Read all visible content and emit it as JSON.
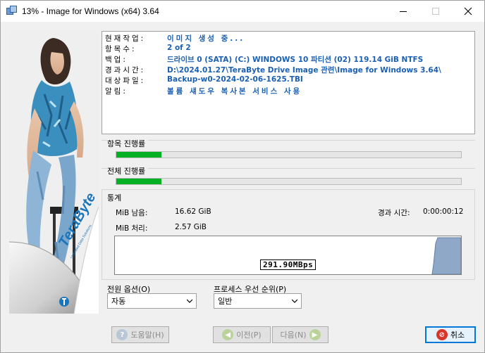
{
  "window": {
    "title": "13% - Image for Windows (x64) 3.64"
  },
  "info": {
    "rows": [
      {
        "label": "현재작업:",
        "value": "이미지 생성 중..."
      },
      {
        "label": "항목수:",
        "value": "2 of 2"
      },
      {
        "label": "백업:",
        "value": "드라이브 0 (SATA) (C:) WINDOWS 10 파티션 (02) 119.14 GiB NTFS"
      },
      {
        "label": "경과시간:",
        "value": "D:\\2024.01.27\\TeraByte Drive Image 관련\\Image for Windows 3.64\\"
      },
      {
        "label": "대상파일:",
        "value": "Backup-w0-2024-02-06-1625.TBI"
      },
      {
        "label": "알림:",
        "value": "볼륨 섀도우 복사본 서비스 사용"
      }
    ]
  },
  "progress": {
    "item_label": "항목 진행률",
    "item_fraction": 0.13,
    "total_label": "전체 진행률",
    "total_fraction": 0.13
  },
  "stats": {
    "label": "통계",
    "mib_remaining_label": "MiB 남음:",
    "mib_remaining_value": "16.62 GiB",
    "mib_processed_label": "MiB 처리:",
    "mib_processed_value": "2.57 GiB",
    "elapsed_label": "경과 시간:",
    "elapsed_value": "0:00:00:12",
    "speed": "291.90MBps"
  },
  "power_option": {
    "label": "전원 옵션(O)",
    "selected": "자동"
  },
  "process_priority": {
    "label": "프로세스 우선 순위(P)",
    "selected": "일반"
  },
  "buttons": {
    "help": "도움말(H)",
    "prev": "이전(P)",
    "next": "다음(N)",
    "cancel": "취소"
  },
  "brand": {
    "logo_text": "TeraByte",
    "logo_tagline": "Unlimited Data Solutions"
  },
  "colors": {
    "accent": "#0078d7",
    "progress": "#06b025",
    "info_text": "#1a5fb4"
  }
}
